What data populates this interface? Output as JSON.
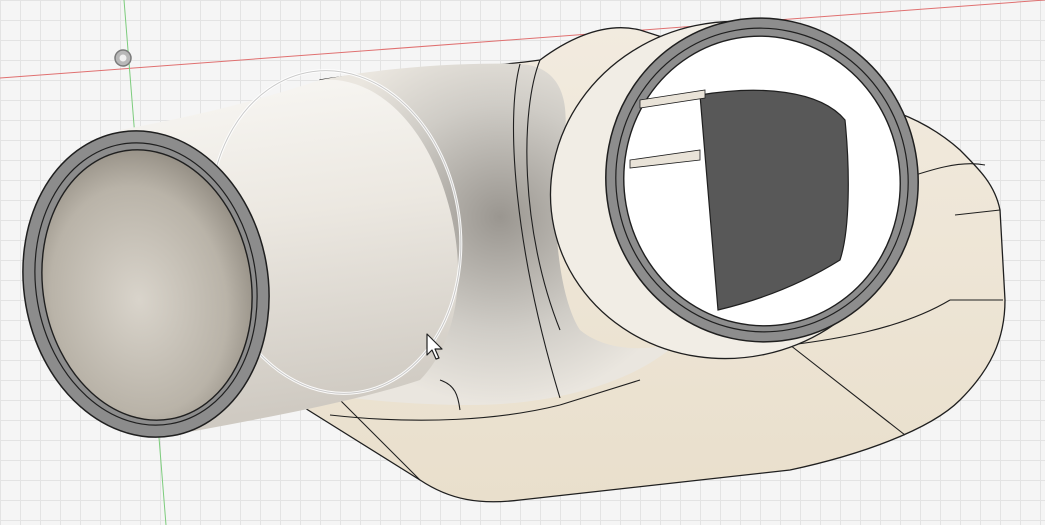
{
  "viewport": {
    "background_color": "#f5f5f5",
    "grid_color": "#dcdcdc",
    "x_axis_color": "#e06060",
    "y_axis_color": "#66cc66"
  },
  "model": {
    "body_color": "#efe7d9",
    "tube_color": "#efebe3",
    "rim_color": "#8f8f8f",
    "shadow_color": "#575757",
    "edge_color": "#1f1f1f"
  },
  "icons": {
    "origin": "origin-point-icon",
    "cursor": "mouse-pointer-icon"
  }
}
